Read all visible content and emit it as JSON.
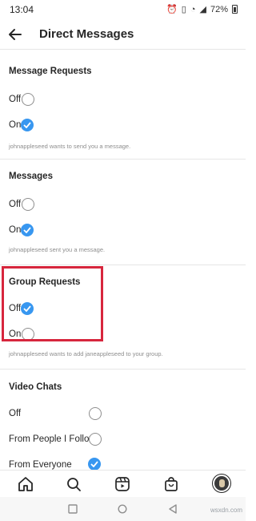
{
  "status_bar": {
    "time": "13:04",
    "battery": "72%"
  },
  "header": {
    "title": "Direct Messages"
  },
  "sections": {
    "message_requests": {
      "title": "Message Requests",
      "off_label": "Off",
      "on_label": "On",
      "caption": "johnappleseed wants to send you a message.",
      "selected": "On"
    },
    "messages": {
      "title": "Messages",
      "off_label": "Off",
      "on_label": "On",
      "caption": "johnappleseed sent you a message.",
      "selected": "On"
    },
    "group_requests": {
      "title": "Group Requests",
      "off_label": "Off",
      "on_label": "On",
      "caption": "johnappleseed wants to add janeappleseed to your group.",
      "selected": "Off"
    },
    "video_chats": {
      "title": "Video Chats",
      "off_label": "Off",
      "people_follow_label": "From People I Follow",
      "everyone_label": "From Everyone",
      "selected": "From Everyone"
    }
  },
  "bottom_nav": [
    "home-icon",
    "search-icon",
    "reels-icon",
    "shop-icon",
    "profile-avatar"
  ],
  "watermark": "wsxdn.com",
  "colors": {
    "accent": "#3897f0",
    "highlight": "#d7263d"
  }
}
